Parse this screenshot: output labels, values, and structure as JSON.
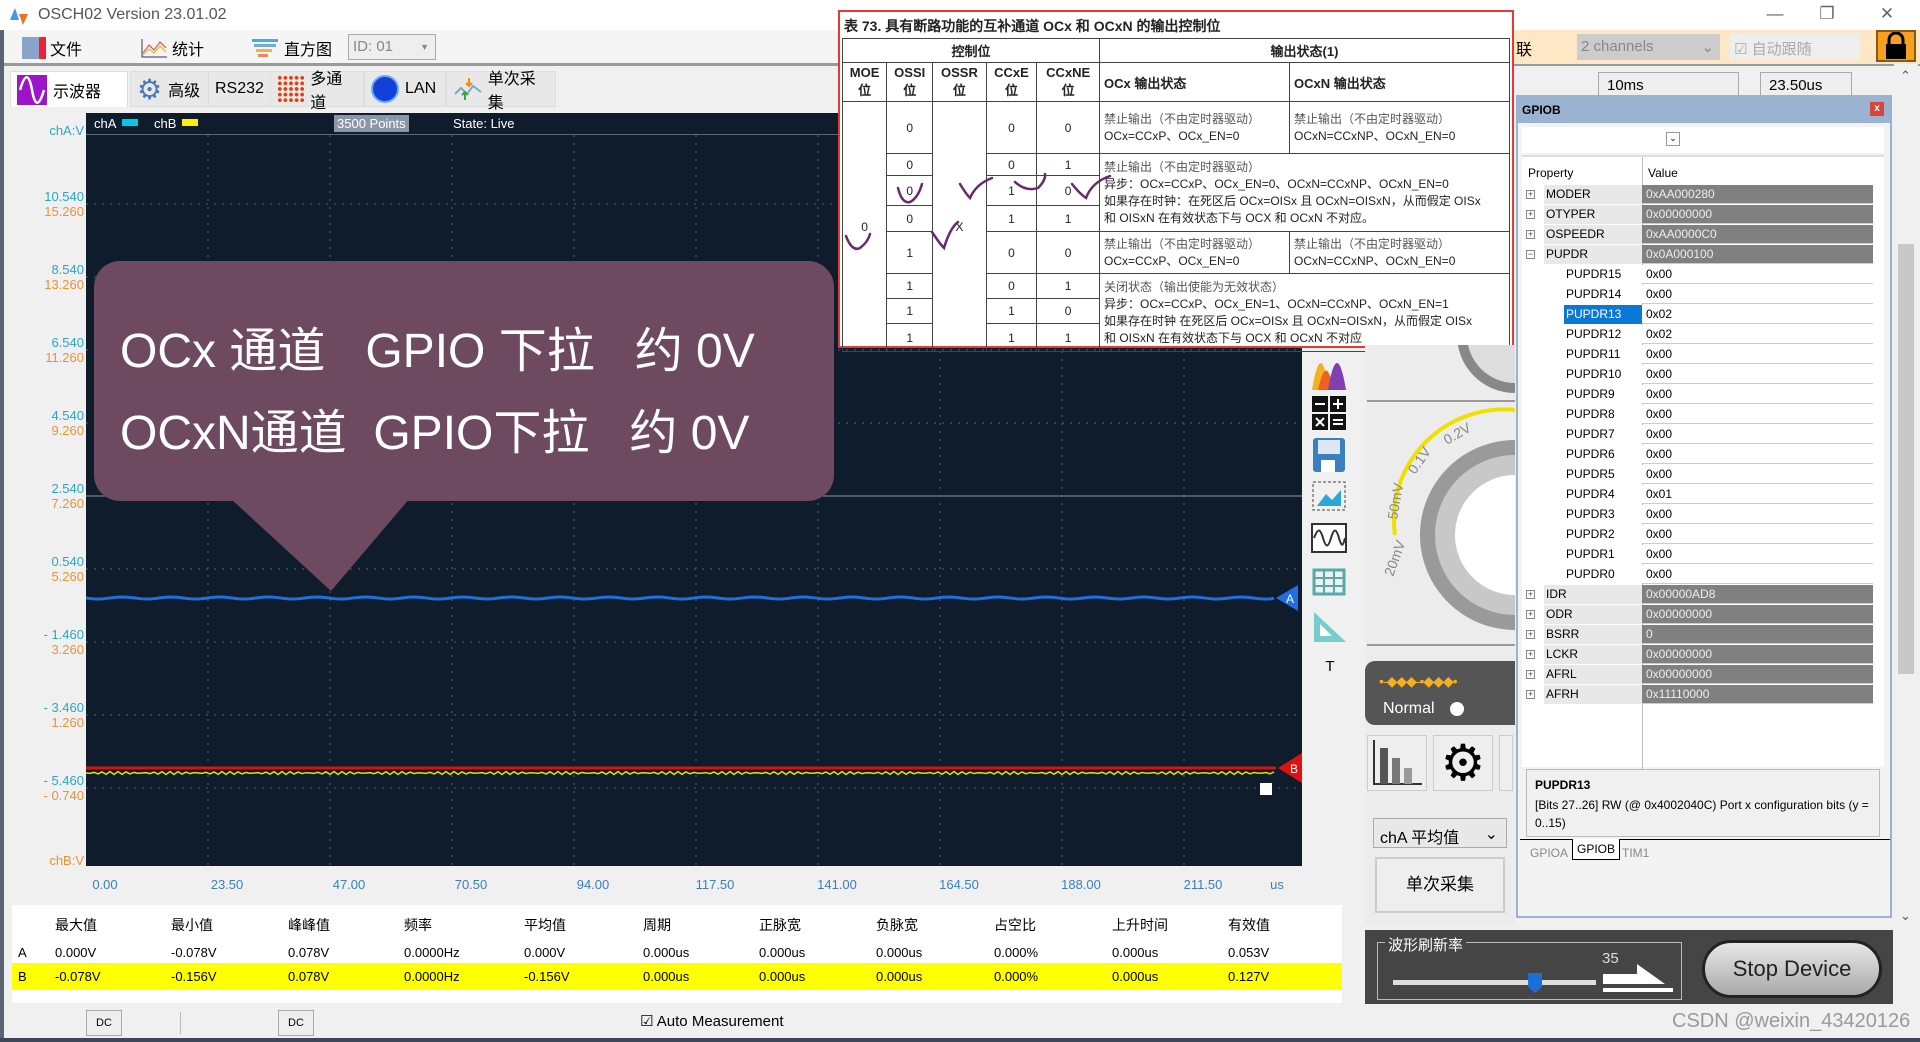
{
  "window": {
    "title": "OSCH02  Version 23.01.02",
    "minimize": "—",
    "restore": "❐",
    "close": "✕"
  },
  "toolbar": {
    "file": "文件",
    "stats": "统计",
    "histogram": "直方图",
    "id_select": "ID: 01"
  },
  "tabs": [
    {
      "label": "示波器",
      "icon": "sine-wave-icon",
      "active": true
    },
    {
      "label": "高级",
      "icon": "gear-icon"
    },
    {
      "label": "RS232"
    },
    {
      "label": "多通道",
      "icon": "grid-dots-icon"
    },
    {
      "label": "LAN",
      "icon": "globe-icon"
    },
    {
      "label": "单次采集",
      "icon": "single-capture-icon"
    }
  ],
  "plot": {
    "legend_a": "chA",
    "legend_b": "chB",
    "points": "3500 Points",
    "state": "State: Live",
    "cha_unit": "chA:V",
    "chb_unit": "chB:V",
    "x_unit": "us",
    "y_a": [
      "10.540",
      "8.540",
      "6.540",
      "4.540",
      "2.540",
      "0.540",
      "- 1.460",
      "- 3.460",
      "- 5.460"
    ],
    "y_b": [
      "15.260",
      "13.260",
      "11.260",
      "9.260",
      "7.260",
      "5.260",
      "3.260",
      "1.260",
      "- 0.740"
    ],
    "x_ticks": [
      "0.00",
      "23.50",
      "47.00",
      "70.50",
      "94.00",
      "117.50",
      "141.00",
      "164.50",
      "188.00",
      "211.50"
    ],
    "marker_a": "A",
    "marker_b": "B",
    "colors": {
      "cha": "#1f6fe0",
      "chb_line": "#e01010",
      "chb_trace": "#e8e000",
      "legend_a": "#00c8e8",
      "legend_b": "#ffee00"
    }
  },
  "callout": {
    "line1": "OCx 通道   GPIO 下拉   约 0V",
    "line2": "OCxN通道  GPIO下拉   约 0V"
  },
  "datasheet": {
    "caption": "表 73.        具有断路功能的互补通道 OCx 和 OCxN 的输出控制位",
    "h_ctrl": "控制位",
    "h_out": "输出状态(1)",
    "cols": [
      "MOE\n位",
      "OSSI\n位",
      "OSSR\n位",
      "CCxE\n位",
      "CCxNE\n位",
      "OCx 输出状态",
      "OCxN 输出状态"
    ],
    "moe": "0",
    "ossr": "X",
    "rows": [
      [
        "0",
        "0",
        "0"
      ],
      [
        "0",
        "0",
        "1"
      ],
      [
        "0",
        "1",
        "0"
      ],
      [
        "0",
        "1",
        "1"
      ],
      [
        "1",
        "0",
        "0"
      ],
      [
        "1",
        "0",
        "1"
      ],
      [
        "1",
        "1",
        "0"
      ],
      [
        "1",
        "1",
        "1"
      ]
    ],
    "ocx_off": [
      "禁止输出（不由定时器驱动）",
      "OCx=CCxP、OCx_EN=0"
    ],
    "ocxn_off": [
      "禁止输出（不由定时器驱动）",
      "OCxN=CCxNP、OCxN_EN=0"
    ],
    "merged1": [
      "禁止输出（不由定时器驱动）",
      "异步：OCx=CCxP、OCx_EN=0、OCxN=CCxNP、OCxN_EN=0",
      "如果存在时钟：在死区后 OCx=OISx 且 OCxN=OISxN，从而假定 OISx",
      "和 OISxN 在有效状态下与 OCX 和 OCxN 不对应。"
    ],
    "merged2": [
      "关闭状态（输出使能为无效状态）",
      "异步：OCx=CCxP、OCx_EN=1、OCxN=CCxNP、OCxN_EN=1",
      "如果存在时钟 在死区后 OCx=OISx 且 OCxN=OISxN，从而假定 OISx",
      "和 OISxN 在有效状态下与 OCX 和 OCxN 不对应"
    ]
  },
  "side_tools": [
    "histogram-icon",
    "calculator-icon",
    "save-icon",
    "screenshot-icon",
    "waveform-icon",
    "table-icon",
    "ruler-icon",
    "text-icon"
  ],
  "side_text_tool": "T",
  "knob": {
    "labels": [
      "20mV",
      "50mV",
      "0.1V",
      "0.2V"
    ],
    "arc_color": "#f0e000"
  },
  "trigger": {
    "mode": "Normal"
  },
  "channel_measure_select": "chA 平均值",
  "single_capture": "单次采集",
  "refresh": {
    "label": "波形刷新率",
    "value": 35,
    "max": 50
  },
  "stop_button": "Stop Device",
  "top_right": {
    "link": "联",
    "channels": "2 channels",
    "auto_follow": "自动跟随",
    "timebase": "10ms",
    "offset": "23.50us"
  },
  "gpio": {
    "title": "GPIOB",
    "close": "x",
    "col_property": "Property",
    "col_value": "Value",
    "registers": [
      {
        "name": "MODER",
        "value": "0xAA000280",
        "group": true,
        "expanded": false
      },
      {
        "name": "OTYPER",
        "value": "0x00000000",
        "group": true,
        "expanded": false
      },
      {
        "name": "OSPEEDR",
        "value": "0xAA0000C0",
        "group": true,
        "expanded": false
      },
      {
        "name": "PUPDR",
        "value": "0x0A000100",
        "group": true,
        "expanded": true
      },
      {
        "name": "PUPDR15",
        "value": "0x00"
      },
      {
        "name": "PUPDR14",
        "value": "0x00"
      },
      {
        "name": "PUPDR13",
        "value": "0x02",
        "selected": true
      },
      {
        "name": "PUPDR12",
        "value": "0x02"
      },
      {
        "name": "PUPDR11",
        "value": "0x00"
      },
      {
        "name": "PUPDR10",
        "value": "0x00"
      },
      {
        "name": "PUPDR9",
        "value": "0x00"
      },
      {
        "name": "PUPDR8",
        "value": "0x00"
      },
      {
        "name": "PUPDR7",
        "value": "0x00"
      },
      {
        "name": "PUPDR6",
        "value": "0x00"
      },
      {
        "name": "PUPDR5",
        "value": "0x00"
      },
      {
        "name": "PUPDR4",
        "value": "0x01"
      },
      {
        "name": "PUPDR3",
        "value": "0x00"
      },
      {
        "name": "PUPDR2",
        "value": "0x00"
      },
      {
        "name": "PUPDR1",
        "value": "0x00"
      },
      {
        "name": "PUPDR0",
        "value": "0x00"
      },
      {
        "name": "IDR",
        "value": "0x00000AD8",
        "group": true,
        "expanded": false
      },
      {
        "name": "ODR",
        "value": "0x00000000",
        "group": true,
        "expanded": false
      },
      {
        "name": "BSRR",
        "value": "0",
        "group": true,
        "expanded": false
      },
      {
        "name": "LCKR",
        "value": "0x00000000",
        "group": true,
        "expanded": false
      },
      {
        "name": "AFRL",
        "value": "0x00000000",
        "group": true,
        "expanded": false
      },
      {
        "name": "AFRH",
        "value": "0x11110000",
        "group": true,
        "expanded": false
      }
    ],
    "desc_title": "PUPDR13",
    "desc_text": "[Bits 27..26] RW (@ 0x4002040C) Port x configuration bits (y = 0..15)",
    "tabs": [
      "GPIOA",
      "GPIOB",
      "TIM1"
    ],
    "active_tab": "GPIOB"
  },
  "measurements": {
    "headers": [
      "最大值",
      "最小值",
      "峰峰值",
      "频率",
      "平均值",
      "周期",
      "正脉宽",
      "负脉宽",
      "占空比",
      "上升时间",
      "有效值"
    ],
    "rows": [
      {
        "ch": "A",
        "values": [
          "0.000V",
          "-0.078V",
          "0.078V",
          "0.0000Hz",
          "0.000V",
          "0.000us",
          "0.000us",
          "0.000us",
          "0.000%",
          "0.000us",
          "0.053V"
        ]
      },
      {
        "ch": "B",
        "values": [
          "-0.078V",
          "-0.156V",
          "0.078V",
          "0.0000Hz",
          "-0.156V",
          "0.000us",
          "0.000us",
          "0.000us",
          "0.000%",
          "0.000us",
          "0.127V"
        ],
        "highlight": "#ffff00"
      }
    ]
  },
  "status": {
    "dc_a": "DC",
    "dc_b": "DC",
    "auto_measure": "Auto Measurement",
    "auto_checked": true
  },
  "watermark": "CSDN @weixin_43420126"
}
